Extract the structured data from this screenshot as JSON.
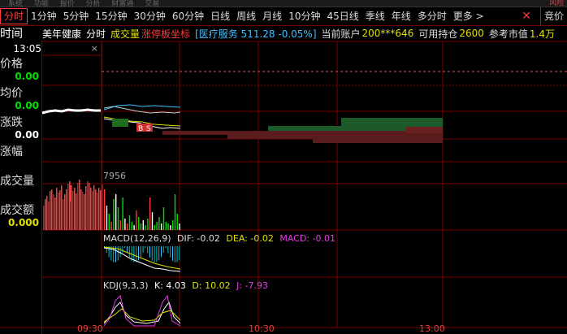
{
  "top_menu": [
    "系统",
    "功能",
    "报价",
    "分析",
    "财富通",
    "交易",
    "风险"
  ],
  "tabs": [
    {
      "label": "分时",
      "active": true
    },
    {
      "label": "1分钟"
    },
    {
      "label": "5分钟"
    },
    {
      "label": "15分钟"
    },
    {
      "label": "30分钟"
    },
    {
      "label": "60分钟"
    },
    {
      "label": "日线"
    },
    {
      "label": "周线"
    },
    {
      "label": "月线"
    },
    {
      "label": "10分钟"
    },
    {
      "label": "45日线"
    },
    {
      "label": "季线"
    },
    {
      "label": "年线"
    },
    {
      "label": "多分时"
    },
    {
      "label": "更多 >"
    }
  ],
  "tab_close": "✕",
  "tab_bidding": "竞价",
  "info": {
    "left_label": "时间",
    "stock_name": "美年健康",
    "mode": "分时",
    "volume_label": "成交量",
    "limit_label": "涨停板坐标",
    "sector": "[医疗服务 511.28 -0.05%]",
    "account_label": "当前账户",
    "account": "200***646",
    "position_label": "可用持仓",
    "position": "2600",
    "market_value_label": "参考市值",
    "market_value": "1.4万"
  },
  "left": {
    "time": "13:05",
    "price_label": "价格",
    "price": "0.00",
    "avg_label": "均价",
    "avg": "0.00",
    "change_label": "涨跌",
    "change": "0.00",
    "pct_label": "涨幅",
    "vol_label": "成交量",
    "amount_label": "成交额",
    "amount": "0.000"
  },
  "mini_close": "×",
  "volume_max_label": "7956",
  "macd": {
    "name": "MACD(12,26,9)",
    "dif": "DIF: -0.02",
    "dea": "DEA: -0.02",
    "macd": "MACD: -0.01"
  },
  "kdj": {
    "name": "KDJ(9,3,3)",
    "k": "K: 4.03",
    "d": "D: 10.02",
    "j": "J: -7.93"
  },
  "time_axis": [
    "09:30",
    "10:30",
    "13:00"
  ],
  "badges": [
    "B",
    "S"
  ],
  "colors": {
    "up": "#ff3b3b",
    "down": "#00e000",
    "grid": "#7a0000",
    "avg": "#e0e000",
    "macd_label": "#e040e0"
  }
}
